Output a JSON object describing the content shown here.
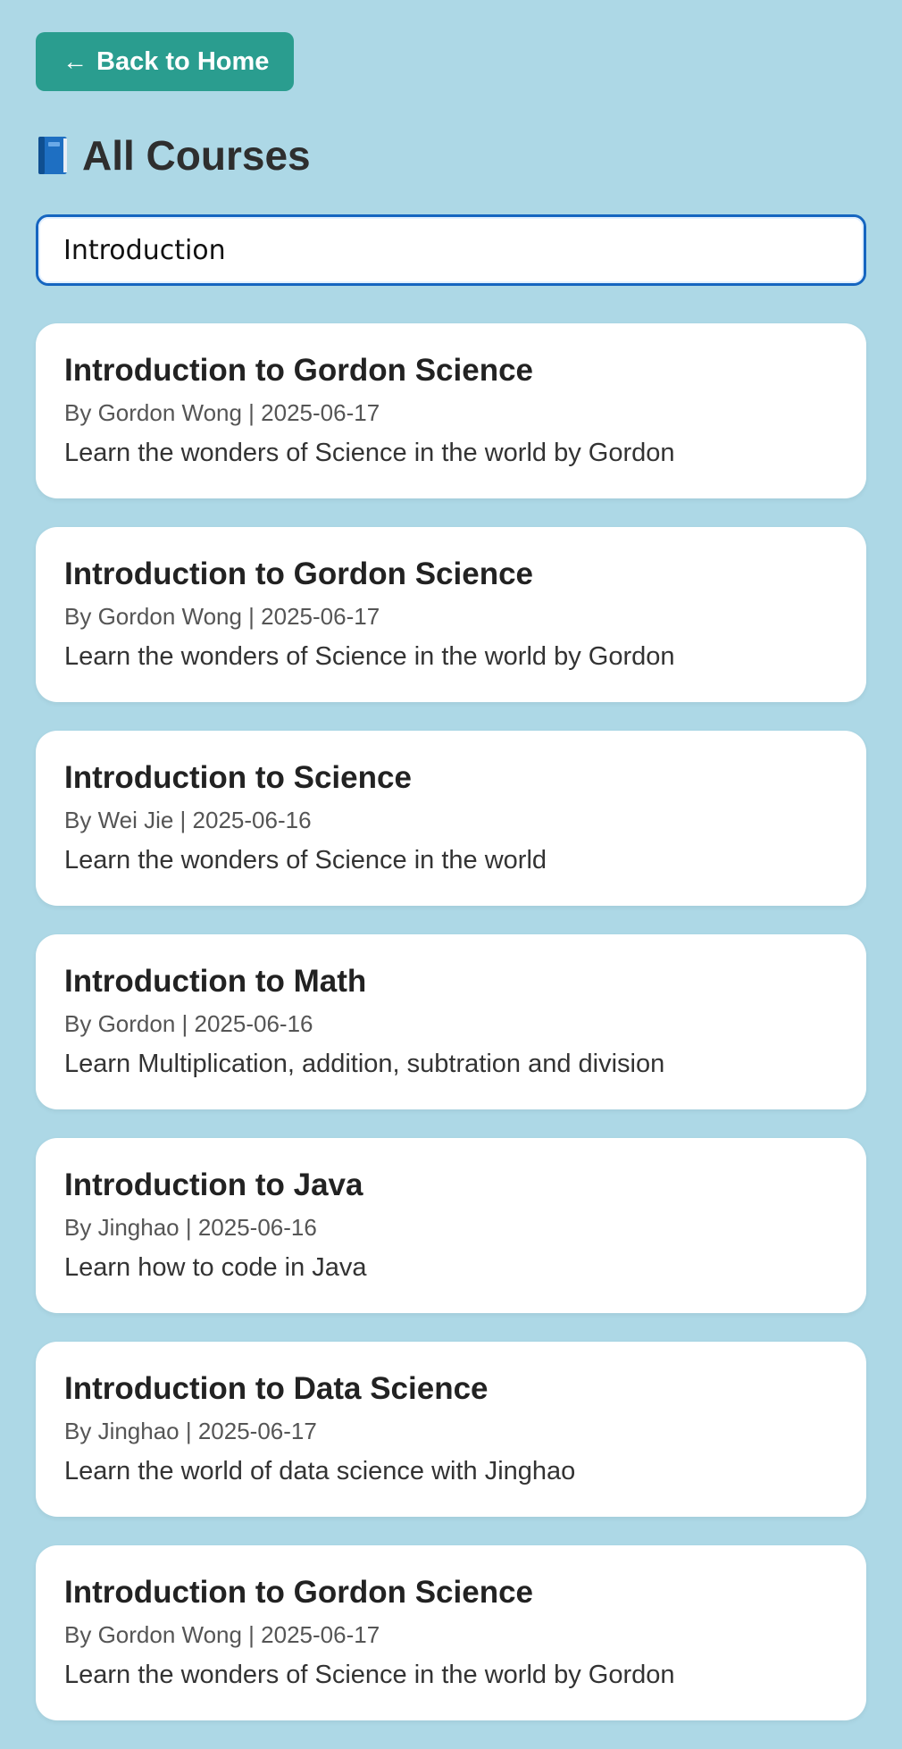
{
  "header": {
    "back_label": "Back to Home",
    "back_icon": "arrow-left-icon",
    "title": "All Courses",
    "title_icon": "blue-book-icon"
  },
  "search": {
    "value": "Introduction",
    "placeholder": ""
  },
  "courses": [
    {
      "title": "Introduction to Gordon Science",
      "meta": "By Gordon Wong | 2025-06-17",
      "description": "Learn the wonders of Science in the world by Gordon"
    },
    {
      "title": "Introduction to Gordon Science",
      "meta": "By Gordon Wong | 2025-06-17",
      "description": "Learn the wonders of Science in the world by Gordon"
    },
    {
      "title": "Introduction to Science",
      "meta": "By Wei Jie | 2025-06-16",
      "description": "Learn the wonders of Science in the world"
    },
    {
      "title": "Introduction to Math",
      "meta": "By Gordon | 2025-06-16",
      "description": "Learn Multiplication, addition, subtration and division"
    },
    {
      "title": "Introduction to Java",
      "meta": "By Jinghao | 2025-06-16",
      "description": "Learn how to code in Java"
    },
    {
      "title": "Introduction to Data Science",
      "meta": "By Jinghao | 2025-06-17",
      "description": "Learn the world of data science with Jinghao"
    },
    {
      "title": "Introduction to Gordon Science",
      "meta": "By Gordon Wong | 2025-06-17",
      "description": "Learn the wonders of Science in the world by Gordon"
    }
  ],
  "colors": {
    "background": "#add8e6",
    "accent": "#2a9d8f",
    "focus": "#1565c0"
  }
}
